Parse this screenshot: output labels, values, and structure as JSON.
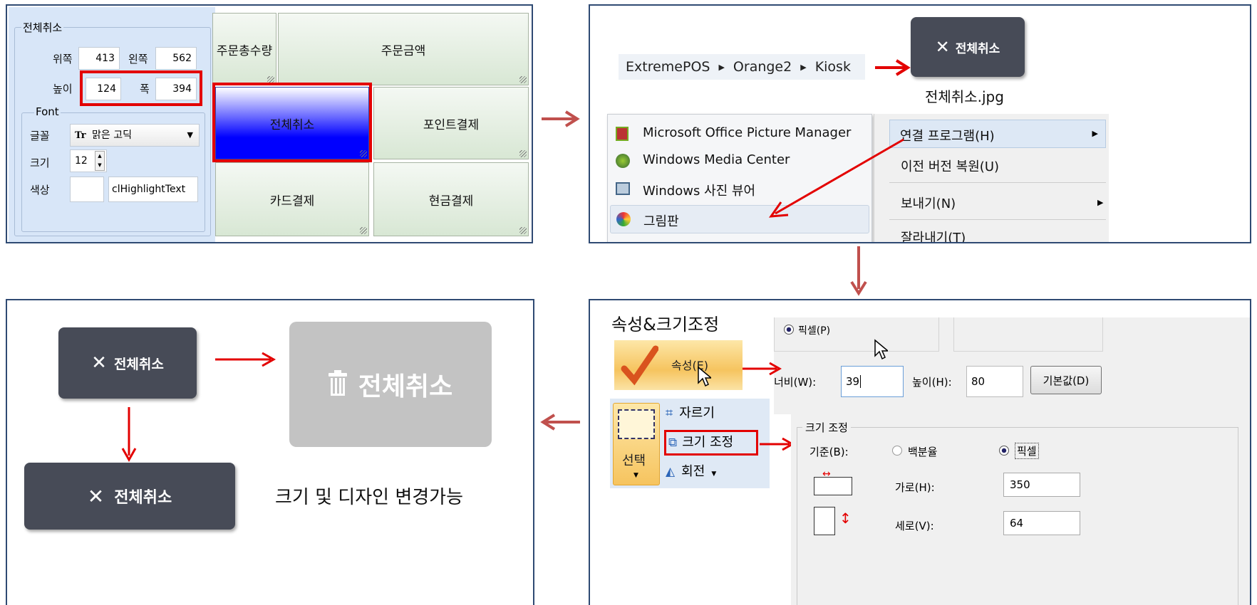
{
  "panel1": {
    "group_title": "전체취소",
    "top_label": "위쪽",
    "top_value": "413",
    "left_label": "왼쪽",
    "left_value": "562",
    "height_label": "높이",
    "height_value": "124",
    "width_label": "폭",
    "width_value": "394",
    "font_group": "Font",
    "font_label": "글꼴",
    "font_value": "맑은 고딕",
    "font_icon": "Tr",
    "size_label": "크기",
    "size_value": "12",
    "color_label": "색상",
    "color_value": "clHighlightText",
    "buttons": {
      "order_qty": "주문총수량",
      "order_amount": "주문금액",
      "cancel_all": "전체취소",
      "point_pay": "포인트결제",
      "card_pay": "카드결제",
      "cash_pay": "현금결제"
    }
  },
  "panel2": {
    "breadcrumb": [
      "ExtremePOS",
      "Orange2",
      "Kiosk"
    ],
    "preview_button": "전체취소",
    "preview_filename": "전체취소.jpg",
    "apps": [
      "Microsoft Office Picture Manager",
      "Windows Media Center",
      "Windows 사진 뷰어",
      "그림판"
    ],
    "context": [
      "연결 프로그램(H)",
      "이전 버전 복원(U)",
      "보내기(N)",
      "잘라내기(T)"
    ]
  },
  "panel3": {
    "heading": "속성&크기조정",
    "pixel_radio": "픽셀(P)",
    "properties_btn": "속성(E)",
    "width_label": "너비(W):",
    "width_value": "39",
    "height_label": "높이(H):",
    "height_value": "80",
    "default_btn": "기본값(D)",
    "select_label": "선택",
    "crop": "자르기",
    "resize": "크기 조정",
    "rotate": "회전",
    "resize_group": "크기 조정",
    "basis_label": "기준(B):",
    "percent_radio": "백분율",
    "pixel_radio2": "픽셀",
    "horiz_label": "가로(H):",
    "horiz_value": "350",
    "vert_label": "세로(V):",
    "vert_value": "64"
  },
  "panel4": {
    "btn_small": "전체취소",
    "btn_gray": "전체취소",
    "btn_wide": "전체취소",
    "caption": "크기 및 디자인 변경가능"
  },
  "colors": {
    "red": "#e30000",
    "flow_arrow": "#c0504d",
    "dark_btn": "#474b57",
    "blue_btn": "#0000ff"
  }
}
